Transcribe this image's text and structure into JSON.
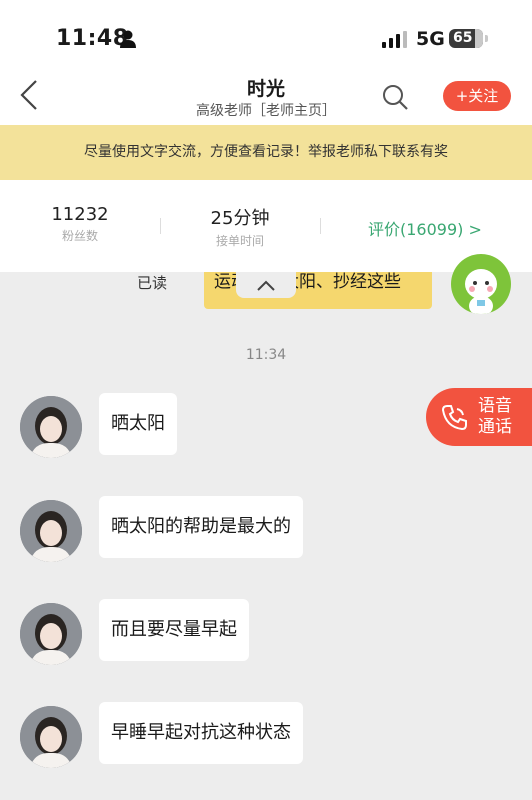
{
  "status_bar": {
    "time": "11:48",
    "network": "5G",
    "battery": "65"
  },
  "nav": {
    "title": "时光",
    "subtitle": "高级老师［老师主页］",
    "follow_label": "+关注"
  },
  "notice": {
    "text": "尽量使用文字交流，方便查看记录！举报老师私下联系有奖"
  },
  "stats": {
    "fans_count": "11232",
    "fans_label": "粉丝数",
    "response_time": "25分钟",
    "response_label": "接单时间",
    "rating_link": "评价(16099) >"
  },
  "chat": {
    "read_status": "已读",
    "my_message": "运动、晒太阳、抄经这些",
    "timestamp": "11:34",
    "messages": [
      "晒太阳",
      "晒太阳的帮助是最大的",
      "而且要尽量早起",
      "早睡早起对抗这种状态"
    ]
  },
  "voice_call": {
    "label_line1": "语音",
    "label_line2": "通话"
  },
  "colors": {
    "accent": "#f2533f",
    "notice_bg": "#f3e29a",
    "rating": "#3aa772",
    "my_bubble": "#f5d76e"
  }
}
